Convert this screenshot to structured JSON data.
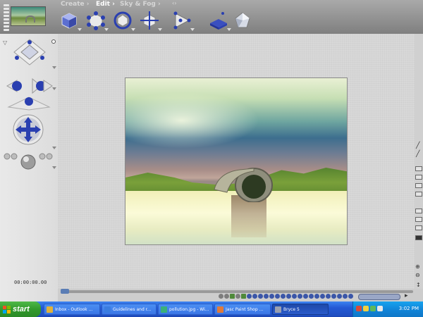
{
  "app": {
    "palette_tabs": [
      {
        "label": "Create",
        "active": false
      },
      {
        "label": "Edit",
        "active": true
      },
      {
        "label": "Sky & Fog",
        "active": false
      }
    ],
    "tools": [
      {
        "name": "material-cube-icon"
      },
      {
        "name": "resize-tool-icon"
      },
      {
        "name": "rotate-tool-icon"
      },
      {
        "name": "reposition-tool-icon"
      },
      {
        "name": "align-tool-icon"
      },
      {
        "name": "randomize-tool-icon"
      },
      {
        "name": "terrain-editor-icon"
      },
      {
        "name": "crystal-object-icon"
      }
    ],
    "time_readout": "00:00:00.00"
  },
  "taskbar": {
    "start_label": "start",
    "tasks": [
      {
        "label": "Inbox - Outlook ...",
        "icon_color": "#e0b23a",
        "active": false
      },
      {
        "label": "Guidelines and r...",
        "icon_color": "#3a7de0",
        "active": false
      },
      {
        "label": "pollution.jpg - Wi...",
        "icon_color": "#3ab07a",
        "active": false
      },
      {
        "label": "Jasc Paint Shop ...",
        "icon_color": "#e07a3a",
        "active": false
      },
      {
        "label": "Bryce 5",
        "icon_color": "#9aa0b0",
        "active": true
      }
    ],
    "clock": "3:02 PM"
  },
  "colors": {
    "taskbar_blue": "#2459d4",
    "start_green": "#329a2c",
    "bryce_blue": "#2a3fb0"
  }
}
